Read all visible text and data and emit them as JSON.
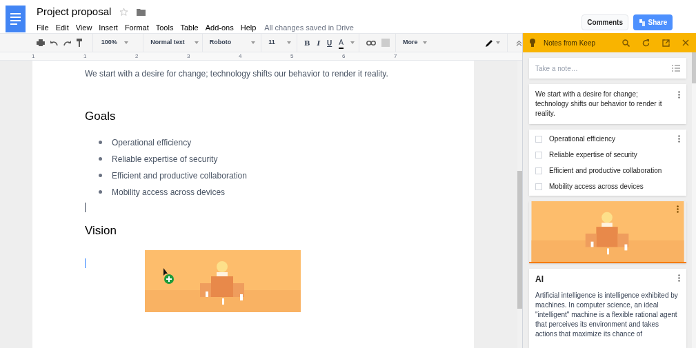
{
  "document": {
    "title": "Project proposal",
    "starred": false,
    "menu": [
      "File",
      "Edit",
      "View",
      "Insert",
      "Format",
      "Tools",
      "Table",
      "Add-ons",
      "Help"
    ],
    "save_status": "All changes saved in Drive"
  },
  "header_buttons": {
    "comments": "Comments",
    "share": "Share"
  },
  "toolbar": {
    "zoom": "100%",
    "style": "Normal text",
    "font": "Roboto",
    "size": "11",
    "more": "More",
    "format_buttons": [
      "B",
      "I",
      "U",
      "A"
    ]
  },
  "ruler_marks": [
    "1",
    "1",
    "2",
    "3",
    "4",
    "5",
    "6",
    "7"
  ],
  "body": [
    {
      "kind": "paragraph",
      "text": "We start with a desire for change; technology shifts our behavior to render it reality."
    },
    {
      "kind": "heading",
      "text": "Goals"
    },
    {
      "kind": "bullets",
      "items": [
        "Operational efficiency",
        "Reliable expertise of security",
        "Efficient and productive collaboration",
        "Mobility access across devices"
      ]
    },
    {
      "kind": "cursor"
    },
    {
      "kind": "heading",
      "text": "Vision"
    },
    {
      "kind": "image"
    }
  ],
  "keep": {
    "title": "Notes from Keep",
    "placeholder": "Take a note…",
    "notes": [
      {
        "kind": "text",
        "text": "We start with a desire for change; technology shifts our behavior to render it reality."
      },
      {
        "kind": "checklist",
        "items": [
          {
            "label": "Operational efficiency",
            "checked": false
          },
          {
            "label": "Reliable expertise of security",
            "checked": false
          },
          {
            "label": "Efficient and productive collaboration",
            "checked": false
          },
          {
            "label": "Mobility access across devices",
            "checked": false
          }
        ]
      },
      {
        "kind": "image"
      },
      {
        "kind": "titled",
        "title": "AI",
        "text": "Artificial intelligence is intelligence exhibited by machines. In computer science, an ideal \"intelligent\" machine is a flexible rational agent that perceives its environment and takes actions that maximize its chance of"
      }
    ]
  }
}
